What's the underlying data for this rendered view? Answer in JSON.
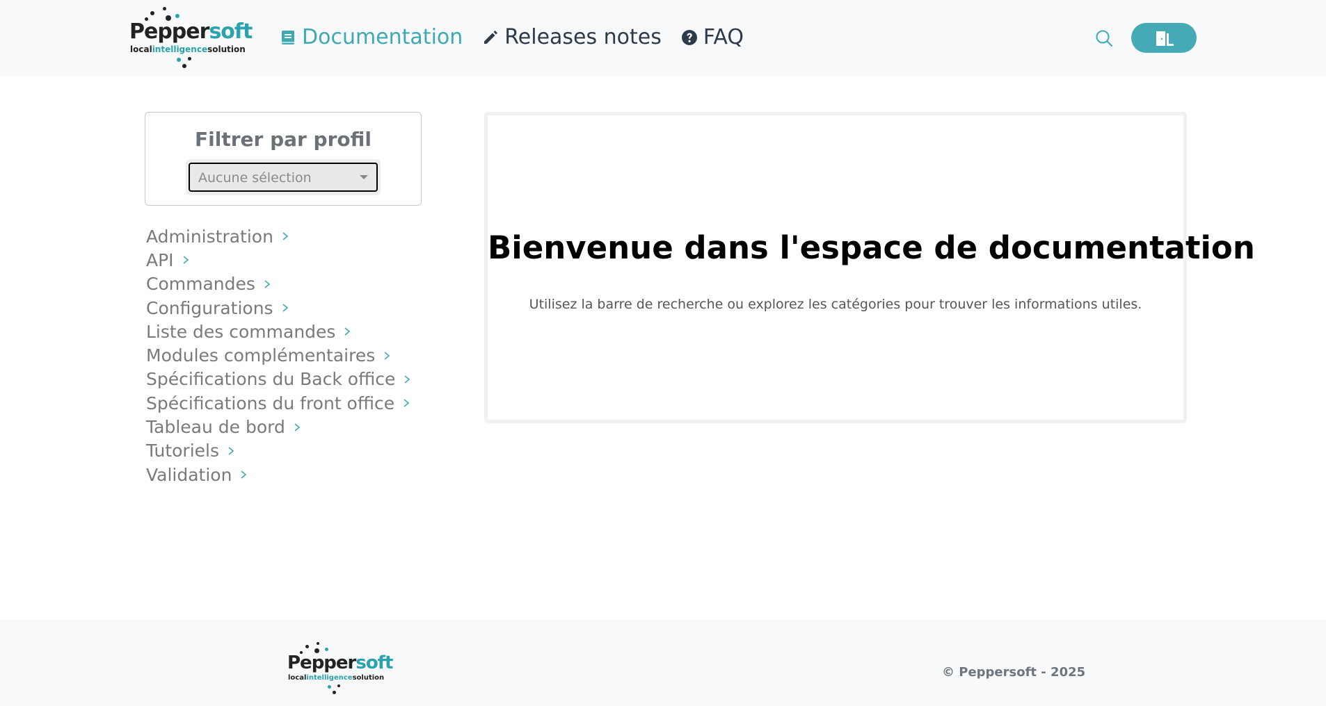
{
  "header": {
    "logo": {
      "brand_dark": "Pepper",
      "brand_accent": "soft",
      "tag_left": "local",
      "tag_mid": "intelligence",
      "tag_right": "solution"
    },
    "nav": [
      {
        "label": "Documentation",
        "icon": "book-icon",
        "active": true
      },
      {
        "label": "Releases notes",
        "icon": "pencil-icon",
        "active": false
      },
      {
        "label": "FAQ",
        "icon": "question-circle-icon",
        "active": false
      }
    ],
    "search_icon": "search-icon",
    "exit_icon": "door-exit-icon"
  },
  "filter": {
    "title": "Filtrer par profil",
    "select_value": "Aucune sélection"
  },
  "categories": [
    "Administration",
    "API",
    "Commandes",
    "Configurations",
    "Liste des commandes",
    "Modules complémentaires",
    "Spécifications du Back office",
    "Spécifications du front office",
    "Tableau de bord",
    "Tutoriels",
    "Validation"
  ],
  "welcome": {
    "title": "Bienvenue dans l'espace de documentation",
    "subtitle": "Utilisez la barre de recherche ou explorez les catégories pour trouver les informations utiles."
  },
  "footer": {
    "copyright": "© Peppersoft - 2025"
  },
  "colors": {
    "accent": "#3fa9b3",
    "button": "#45aab5",
    "nav_text": "#2d3a4a"
  }
}
